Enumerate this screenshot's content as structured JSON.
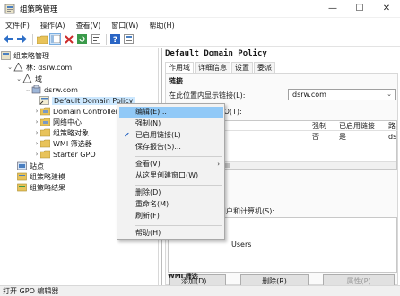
{
  "window": {
    "title": "组策略管理",
    "minimize": "—",
    "maximize": "☐",
    "close": "✕"
  },
  "menu": [
    "文件(F)",
    "操作(A)",
    "查看(V)",
    "窗口(W)",
    "帮助(H)"
  ],
  "tree": {
    "root": "组策略管理",
    "forest": "林: dsrw.com",
    "domains": "域",
    "domain": "dsrw.com",
    "gpo_link": "Default Domain Policy",
    "dc_ou": "Domain Controllers",
    "network_center": "网络中心",
    "gpo_objects": "组策略对象",
    "wmi_filters": "WMI 筛选器",
    "starter_gpo": "Starter GPO",
    "sites": "站点",
    "modeling": "组策略建模",
    "results": "组策略结果"
  },
  "right": {
    "header": "Default Domain Policy",
    "tabs": [
      "作用域",
      "详细信息",
      "设置",
      "委派"
    ],
    "links_title": "链接",
    "links_label": "在此位置内显示链接(L):",
    "domain_value": "dsrw.com",
    "links_desc": "单位链接到此 GPO(T):",
    "table_headers": {
      "enforced": "强制",
      "link_enabled": "已启用链接",
      "path": "路"
    },
    "table_row": {
      "enforced": "否",
      "link_enabled": "是",
      "path": "ds"
    },
    "filter_desc": "应用于下列组、用户和计算机(S):",
    "filter_item": "Users",
    "buttons": {
      "add": "添加(D)...",
      "remove": "删除(R)",
      "properties": "属性(P)"
    },
    "wmi_partial": "WMI 筛选"
  },
  "context_menu": {
    "edit": "编辑(E)...",
    "enforced": "强制(N)",
    "link_enabled": "已启用链接(L)",
    "save_report": "保存报告(S)...",
    "view": "查看(V)",
    "new_window": "从这里创建窗口(W)",
    "delete": "删除(D)",
    "rename": "重命名(M)",
    "refresh": "刷新(F)",
    "help": "帮助(H)"
  },
  "status": "打开 GPO 编辑器"
}
